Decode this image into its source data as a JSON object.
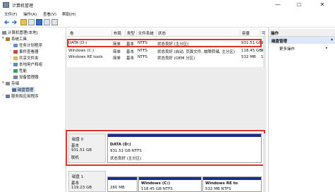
{
  "window": {
    "title": "计算机管理",
    "minimize": "—",
    "maximize": "☐",
    "close": "✕"
  },
  "menu": [
    "文件(F)",
    "操作(A)",
    "查看(V)",
    "帮助(H)"
  ],
  "tree": {
    "root": "计算机管理(本地)",
    "system_tools": "系统工具",
    "task_scheduler": "任务计划程序",
    "event_viewer": "事件查看器",
    "shared_folders": "共享文件夹",
    "local_users": "本地用户和组",
    "performance": "性能",
    "device_manager": "设备管理器",
    "storage": "存储",
    "disk_management": "磁盘管理",
    "services": "服务和应用程序"
  },
  "columns": [
    "卷",
    "布局",
    "类型",
    "文件系统",
    "状态",
    "容量",
    "可"
  ],
  "volumes": [
    {
      "name": "DATA (D:)",
      "layout": "简单",
      "type": "基本",
      "fs": "NTFS",
      "status": "状态良好 (主分区)",
      "capacity": "931.51 GB",
      "free": "93"
    },
    {
      "name": "Windows (C:)",
      "layout": "简单",
      "type": "基本",
      "fs": "NTFS",
      "status": "状态良好 (启动, 页面文件, 故障转储, 主分区)",
      "capacity": "118.45 GB",
      "free": "95"
    },
    {
      "name": "Windows RE tools",
      "layout": "简单",
      "type": "基本",
      "fs": "NTFS",
      "status": "状态良好 (OEM 分区)",
      "capacity": "532 MB",
      "free": "14"
    }
  ],
  "disk0": {
    "name": "磁盘 0",
    "type": "基本",
    "size": "931.51 GB",
    "status": "联机",
    "part_name": "DATA (D:)",
    "part_size": "931.51 GB NTFS",
    "part_status": "状态良好 (主分区)"
  },
  "disk1": {
    "name": "磁盘 1",
    "type": "基本",
    "size": "119.23 GB",
    "p1_size": "260 MB",
    "p2_name": "Windows (C:)",
    "p2_size": "118.45 GB NTFS",
    "p3_name": "Windows RE to",
    "p3_size": "532 MB NTFS"
  },
  "actions": {
    "header": "操作",
    "selected": "磁盘管理",
    "more": "更多操作"
  },
  "colors": {
    "highlight": "#e0302a",
    "partition_bar": "#1c2e8a"
  }
}
